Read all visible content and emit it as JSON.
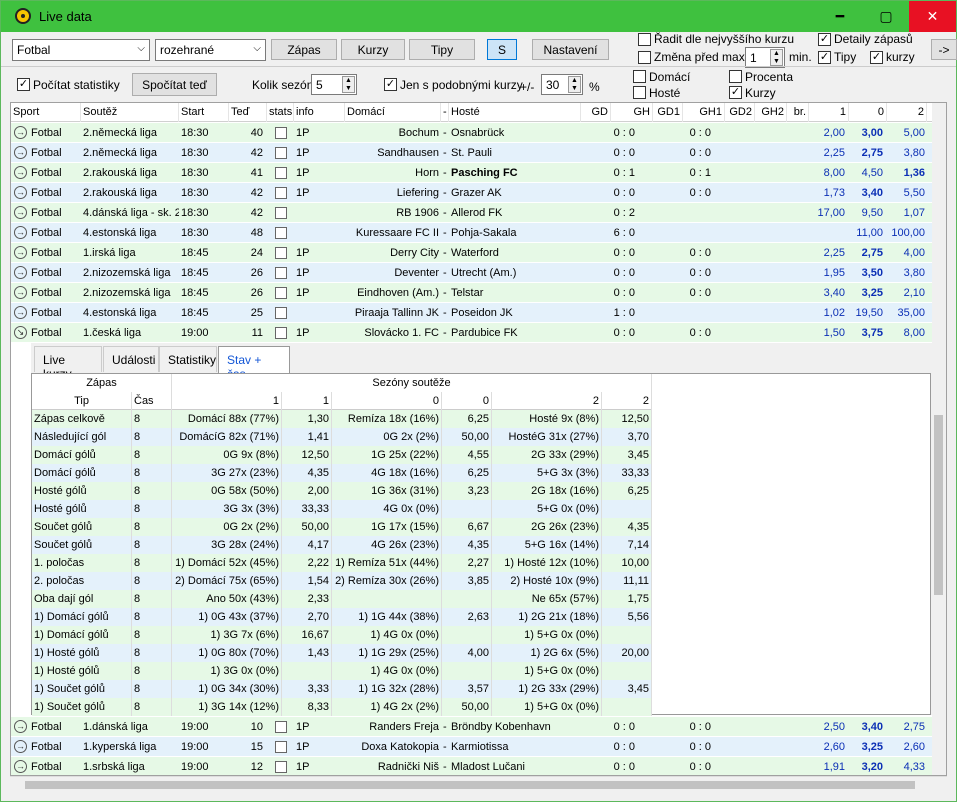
{
  "window": {
    "title": "Live data",
    "min": "━",
    "max": "▢",
    "close": "✕"
  },
  "toolbar": {
    "sport": "Fotbal",
    "filter": "rozehrané",
    "btn_zapas": "Zápas",
    "btn_kurzy": "Kurzy",
    "btn_tipy": "Tipy",
    "btn_s": "S",
    "btn_nastaveni": "Nastavení",
    "radit": "Řadit dle nejvyššího kurzu",
    "zmena": "Změna před max.",
    "zmena_val": "1",
    "min": "min.",
    "detaily": "Detaily zápasů",
    "tipy": "Tipy",
    "kurzy": "kurzy",
    "arrow": "->"
  },
  "toolbar2": {
    "pocitat": "Počítat statistiky",
    "spocitat": "Spočítat teď",
    "kolik": "Kolik sezón",
    "kolik_val": "5",
    "jen": "Jen s podobnými kurzy",
    "pm": "+/-",
    "pm_val": "30",
    "pct": "%",
    "domaci": "Domácí",
    "hoste": "Hosté",
    "procenta": "Procenta",
    "kurzy2": "Kurzy"
  },
  "columns": [
    "Sport",
    "Soutěž",
    "Start",
    "Teď",
    "stats",
    "info",
    "Domácí",
    "-",
    "Hosté",
    "GD",
    "GH",
    "GD1",
    "GH1",
    "GD2",
    "GH2",
    "br.",
    "1",
    "0",
    "2"
  ],
  "matches": [
    {
      "sport": "Fotbal",
      "league": "2.německá liga",
      "start": "18:30",
      "now": "40",
      "info": "1P",
      "home": "Bochum",
      "away": "Osnabrück",
      "score": "0 : 0",
      "half": "0 : 0",
      "o1": "2,00",
      "o0": "3,00",
      "o2": "5,00",
      "bold": "0"
    },
    {
      "sport": "Fotbal",
      "league": "2.německá liga",
      "start": "18:30",
      "now": "42",
      "info": "1P",
      "home": "Sandhausen",
      "away": "St. Pauli",
      "score": "0 : 0",
      "half": "0 : 0",
      "o1": "2,25",
      "o0": "2,75",
      "o2": "3,80",
      "bold": "0"
    },
    {
      "sport": "Fotbal",
      "league": "2.rakouská liga",
      "start": "18:30",
      "now": "41",
      "info": "1P",
      "home": "Horn",
      "away": "Pasching FC",
      "score": "0 : 1",
      "half": "0 : 1",
      "o1": "8,00",
      "o0": "4,50",
      "o2": "1,36",
      "bold": "2",
      "awaybold": true
    },
    {
      "sport": "Fotbal",
      "league": "2.rakouská liga",
      "start": "18:30",
      "now": "42",
      "info": "1P",
      "home": "Liefering",
      "away": "Grazer AK",
      "score": "0 : 0",
      "half": "0 : 0",
      "o1": "1,73",
      "o0": "3,40",
      "o2": "5,50",
      "bold": "0"
    },
    {
      "sport": "Fotbal",
      "league": "4.dánská liga - sk. 2",
      "start": "18:30",
      "now": "42",
      "info": "",
      "home": "RB 1906",
      "away": "Allerod FK",
      "score": "0 : 2",
      "half": "",
      "o1": "17,00",
      "o0": "9,50",
      "o2": "1,07",
      "bold": ""
    },
    {
      "sport": "Fotbal",
      "league": "4.estonská liga",
      "start": "18:30",
      "now": "48",
      "info": "",
      "home": "Kuressaare FC II",
      "away": "Pohja-Sakala",
      "score": "6 : 0",
      "half": "",
      "o1": "",
      "o0": "11,00",
      "o2": "100,00",
      "bold": ""
    },
    {
      "sport": "Fotbal",
      "league": "1.irská liga",
      "start": "18:45",
      "now": "24",
      "info": "1P",
      "home": "Derry City",
      "away": "Waterford",
      "score": "0 : 0",
      "half": "0 : 0",
      "o1": "2,25",
      "o0": "2,75",
      "o2": "4,00",
      "bold": "0"
    },
    {
      "sport": "Fotbal",
      "league": "2.nizozemská liga",
      "start": "18:45",
      "now": "26",
      "info": "1P",
      "home": "Deventer",
      "away": "Utrecht (Am.)",
      "score": "0 : 0",
      "half": "0 : 0",
      "o1": "1,95",
      "o0": "3,50",
      "o2": "3,80",
      "bold": "0"
    },
    {
      "sport": "Fotbal",
      "league": "2.nizozemská liga",
      "start": "18:45",
      "now": "26",
      "info": "1P",
      "home": "Eindhoven (Am.)",
      "away": "Telstar",
      "score": "0 : 0",
      "half": "0 : 0",
      "o1": "3,40",
      "o0": "3,25",
      "o2": "2,10",
      "bold": "0"
    },
    {
      "sport": "Fotbal",
      "league": "4.estonská liga",
      "start": "18:45",
      "now": "25",
      "info": "",
      "home": "Piraaja Tallinn JK",
      "away": "Poseidon JK",
      "score": "1 : 0",
      "half": "",
      "o1": "1,02",
      "o0": "19,50",
      "o2": "35,00",
      "bold": ""
    },
    {
      "sport": "Fotbal",
      "league": "1.česká liga",
      "start": "19:00",
      "now": "11",
      "info": "1P",
      "home": "Slovácko 1. FC",
      "away": "Pardubice FK",
      "score": "0 : 0",
      "half": "0 : 0",
      "o1": "1,50",
      "o0": "3,75",
      "o2": "8,00",
      "bold": "0"
    }
  ],
  "matches2": [
    {
      "sport": "Fotbal",
      "league": "1.dánská liga",
      "start": "19:00",
      "now": "10",
      "info": "1P",
      "home": "Randers Freja",
      "away": "Bröndby Kobenhavn",
      "score": "0 : 0",
      "half": "0 : 0",
      "o1": "2,50",
      "o0": "3,40",
      "o2": "2,75",
      "bold": "0"
    },
    {
      "sport": "Fotbal",
      "league": "1.kyperská liga",
      "start": "19:00",
      "now": "15",
      "info": "1P",
      "home": "Doxa Katokopia",
      "away": "Karmiotissa",
      "score": "0 : 0",
      "half": "0 : 0",
      "o1": "2,60",
      "o0": "3,25",
      "o2": "2,60",
      "bold": "0"
    },
    {
      "sport": "Fotbal",
      "league": "1.srbská liga",
      "start": "19:00",
      "now": "12",
      "info": "1P",
      "home": "Radnički Niš",
      "away": "Mladost Lučani",
      "score": "0 : 0",
      "half": "0 : 0",
      "o1": "1,91",
      "o0": "3,20",
      "o2": "4,33",
      "bold": "0"
    }
  ],
  "tabs": [
    "Live kurzy",
    "Události",
    "Statistiky",
    "Stav + čas"
  ],
  "inner": {
    "h_zapas": "Zápas",
    "h_sezony": "Sezóny soutěže",
    "h_tip": "Tip",
    "h_cas": "Čas",
    "sub": [
      "1",
      "1",
      "0",
      "0",
      "2",
      "2"
    ],
    "rows": [
      [
        "Zápas celkově",
        "8",
        "Domácí 88x (77%)",
        "1,30",
        "Remíza 18x (16%)",
        "6,25",
        "Hosté 9x (8%)",
        "12,50"
      ],
      [
        "Následující gól",
        "8",
        "DomácíG 82x (71%)",
        "1,41",
        "0G 2x (2%)",
        "50,00",
        "HostéG 31x (27%)",
        "3,70"
      ],
      [
        "Domácí gólů",
        "8",
        "0G 9x (8%)",
        "12,50",
        "1G 25x (22%)",
        "4,55",
        "2G 33x (29%)",
        "3,45"
      ],
      [
        "Domácí gólů",
        "8",
        "3G 27x (23%)",
        "4,35",
        "4G 18x (16%)",
        "6,25",
        "5+G 3x (3%)",
        "33,33"
      ],
      [
        "Hosté gólů",
        "8",
        "0G 58x (50%)",
        "2,00",
        "1G 36x (31%)",
        "3,23",
        "2G 18x (16%)",
        "6,25"
      ],
      [
        "Hosté gólů",
        "8",
        "3G 3x (3%)",
        "33,33",
        "4G 0x (0%)",
        "",
        "5+G 0x (0%)",
        ""
      ],
      [
        "Součet gólů",
        "8",
        "0G 2x (2%)",
        "50,00",
        "1G 17x (15%)",
        "6,67",
        "2G 26x (23%)",
        "4,35"
      ],
      [
        "Součet gólů",
        "8",
        "3G 28x (24%)",
        "4,17",
        "4G 26x (23%)",
        "4,35",
        "5+G 16x (14%)",
        "7,14"
      ],
      [
        "1. poločas",
        "8",
        "1) Domácí 52x (45%)",
        "2,22",
        "1) Remíza 51x (44%)",
        "2,27",
        "1) Hosté 12x (10%)",
        "10,00"
      ],
      [
        "2. poločas",
        "8",
        "2) Domácí 75x (65%)",
        "1,54",
        "2) Remíza 30x (26%)",
        "3,85",
        "2) Hosté 10x (9%)",
        "11,11"
      ],
      [
        "Oba dají gól",
        "8",
        "Ano 50x (43%)",
        "2,33",
        "",
        "",
        "Ne 65x (57%)",
        "1,75"
      ],
      [
        "1) Domácí gólů",
        "8",
        "1) 0G 43x (37%)",
        "2,70",
        "1) 1G 44x (38%)",
        "2,63",
        "1) 2G 21x (18%)",
        "5,56"
      ],
      [
        "1) Domácí gólů",
        "8",
        "1) 3G 7x (6%)",
        "16,67",
        "1) 4G 0x (0%)",
        "",
        "1) 5+G 0x (0%)",
        ""
      ],
      [
        "1) Hosté gólů",
        "8",
        "1) 0G 80x (70%)",
        "1,43",
        "1) 1G 29x (25%)",
        "4,00",
        "1) 2G 6x (5%)",
        "20,00"
      ],
      [
        "1) Hosté gólů",
        "8",
        "1) 3G 0x (0%)",
        "",
        "1) 4G 0x (0%)",
        "",
        "1) 5+G 0x (0%)",
        ""
      ],
      [
        "1) Součet gólů",
        "8",
        "1) 0G 34x (30%)",
        "3,33",
        "1) 1G 32x (28%)",
        "3,57",
        "1) 2G 33x (29%)",
        "3,45"
      ],
      [
        "1) Součet gólů",
        "8",
        "1) 3G 14x (12%)",
        "8,33",
        "1) 4G 2x (2%)",
        "50,00",
        "1) 5+G 0x (0%)",
        ""
      ]
    ]
  },
  "colors": {
    "titlebar": "#3fc13f",
    "row_green": "#e6f9e6",
    "row_blue": "#e4f1fb",
    "odds_blue": "#0b2fb5"
  }
}
